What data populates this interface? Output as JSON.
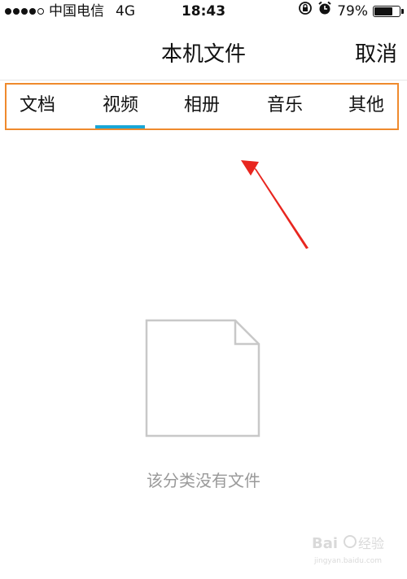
{
  "status_bar": {
    "carrier": "中国电信",
    "network": "4G",
    "time": "18:43",
    "battery_percent": "79%",
    "battery_level": 0.79
  },
  "nav": {
    "title": "本机文件",
    "cancel": "取消"
  },
  "tabs": [
    {
      "label": "文档",
      "selected": false
    },
    {
      "label": "视频",
      "selected": true
    },
    {
      "label": "相册",
      "selected": false
    },
    {
      "label": "音乐",
      "selected": false
    },
    {
      "label": "其他",
      "selected": false
    }
  ],
  "empty_state": {
    "message": "该分类没有文件"
  },
  "colors": {
    "accent": "#1aa7d6",
    "highlight_box": "#ef8a2d",
    "arrow": "#e8261f",
    "muted_text": "#999999"
  },
  "watermark": {
    "text": "Baidu 经验",
    "url": "jingyan.baidu.com"
  }
}
